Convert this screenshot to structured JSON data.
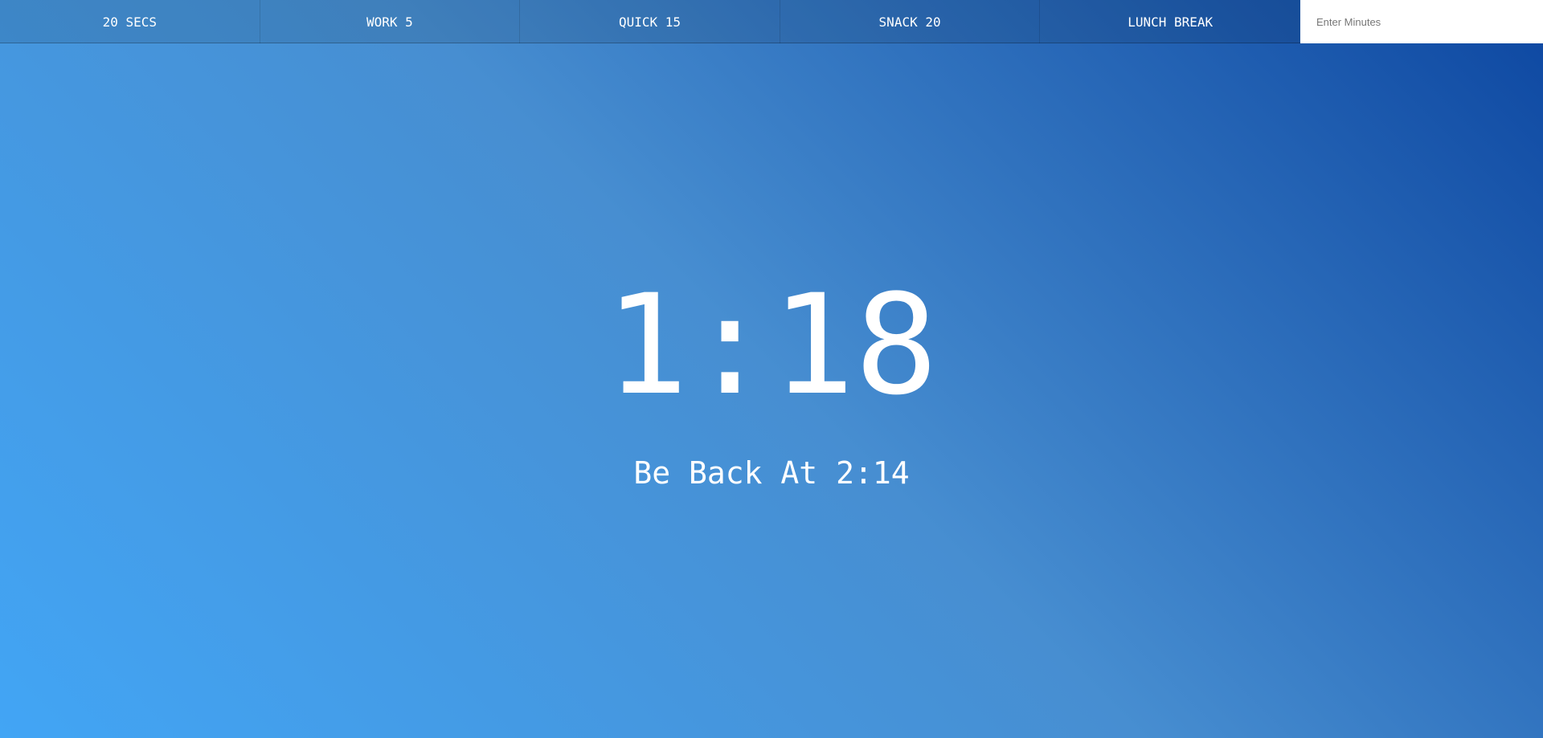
{
  "controls": {
    "buttons": [
      {
        "label": "20 Secs"
      },
      {
        "label": "Work 5"
      },
      {
        "label": "Quick 15"
      },
      {
        "label": "Snack 20"
      },
      {
        "label": "Lunch Break"
      }
    ],
    "minutes_input": {
      "placeholder": "Enter Minutes",
      "value": ""
    }
  },
  "display": {
    "time_left": "1:18",
    "end_time": "Be Back At 2:14"
  },
  "colors": {
    "gradient_start": "#42a5f5",
    "gradient_mid": "#478ed1",
    "gradient_end": "#0d47a1",
    "text": "#ffffff"
  }
}
